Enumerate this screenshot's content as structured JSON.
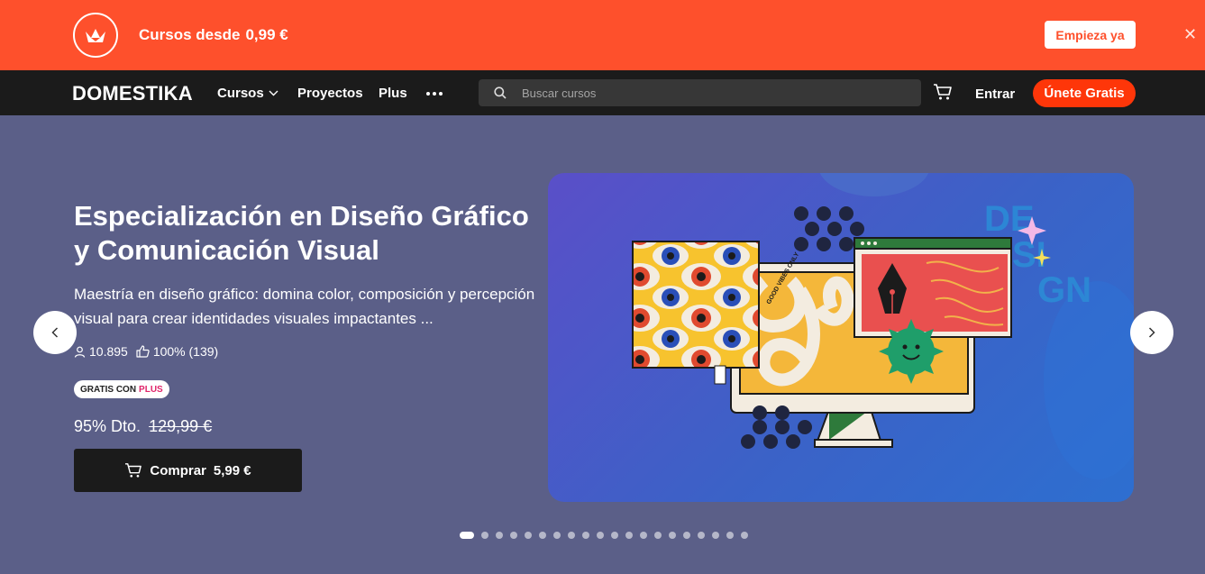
{
  "promo": {
    "text": "Cursos desde",
    "price": "0,99 €",
    "cta": "Empieza ya",
    "close_icon": "close-icon",
    "logo_icon": "crown-icon"
  },
  "nav": {
    "logo": "DOMESTIKA",
    "items": [
      "Cursos",
      "Proyectos",
      "Plus"
    ],
    "more_icon": "more-dots-icon",
    "search_placeholder": "Buscar cursos",
    "cart_icon": "cart-icon",
    "login": "Entrar",
    "signup": "Únete Gratis"
  },
  "hero": {
    "title": "Especialización en Diseño Gráfico y Comunicación Visual",
    "description": "Maestría en diseño gráfico: domina color, composición y percepción visual para crear identidades visuales impactantes ...",
    "students": "10.895",
    "rating": "100% (139)",
    "badge": "GRATIS CON",
    "badge_plus": "PLUS",
    "discount": "95% Dto.",
    "old_price": "129,99 €",
    "buy_label": "Comprar",
    "buy_price": "5,99 €",
    "image_text": [
      "DE",
      "SI",
      "GN"
    ],
    "ribbon_text": "GOOD VIBES ONLY",
    "slides_total": 20,
    "slide_active": 1
  },
  "colors": {
    "promo_bg": "#fe502c",
    "nav_bg": "#1b1b1b",
    "hero_bg": "#5b5f88",
    "signup_bg": "#fe3609",
    "plus_accent": "#e0246a"
  }
}
